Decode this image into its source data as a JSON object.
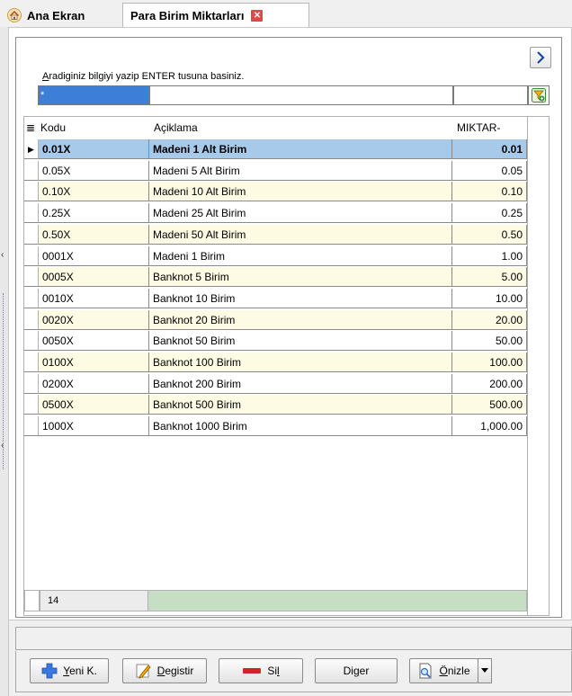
{
  "tabs": [
    {
      "label": "Ana Ekran",
      "icon": "home-icon"
    },
    {
      "label": "Para Birim Miktarları",
      "icon": "close-icon"
    }
  ],
  "search": {
    "hint_first": "A",
    "hint_rest": "radiginiz bilgiyi yazip ENTER tusuna basiniz.",
    "value": "*"
  },
  "grid": {
    "columns": [
      "Kodu",
      "Açiklama",
      "MIKTAR-"
    ],
    "rows": [
      {
        "code": "0.01X",
        "desc": "Madeni 1 Alt Birim",
        "amount": "0.01"
      },
      {
        "code": "0.05X",
        "desc": "Madeni 5 Alt Birim",
        "amount": "0.05"
      },
      {
        "code": "0.10X",
        "desc": "Madeni 10 Alt Birim",
        "amount": "0.10"
      },
      {
        "code": "0.25X",
        "desc": "Madeni 25 Alt Birim",
        "amount": "0.25"
      },
      {
        "code": "0.50X",
        "desc": "Madeni 50 Alt Birim",
        "amount": "0.50"
      },
      {
        "code": "0001X",
        "desc": "Madeni 1 Birim",
        "amount": "1.00"
      },
      {
        "code": "0005X",
        "desc": "Banknot 5 Birim",
        "amount": "5.00"
      },
      {
        "code": "0010X",
        "desc": "Banknot 10 Birim",
        "amount": "10.00"
      },
      {
        "code": "0020X",
        "desc": "Banknot 20 Birim",
        "amount": "20.00"
      },
      {
        "code": "0050X",
        "desc": "Banknot 50 Birim",
        "amount": "50.00"
      },
      {
        "code": "0100X",
        "desc": "Banknot 100 Birim",
        "amount": "100.00"
      },
      {
        "code": "0200X",
        "desc": "Banknot 200 Birim",
        "amount": "200.00"
      },
      {
        "code": "0500X",
        "desc": "Banknot 500 Birim",
        "amount": "500.00"
      },
      {
        "code": "1000X",
        "desc": "Banknot 1000 Birim",
        "amount": "1,000.00"
      }
    ],
    "selected_index": 0,
    "record_count": "14"
  },
  "buttons": {
    "new": {
      "u": "Y",
      "rest": "eni K."
    },
    "edit": {
      "u": "D",
      "rest": "egistir"
    },
    "delete": {
      "pre": "Si",
      "u": "l",
      "rest": ""
    },
    "other": {
      "pre": "Di",
      "u": "g",
      "rest": "er"
    },
    "preview": {
      "u": "Ö",
      "rest": "nizle"
    }
  },
  "colors": {
    "selected_row": "#a7c9ea",
    "alt_row": "#fdfbe3",
    "footer_green": "#c6dfc4",
    "tab_close": "#e04848"
  }
}
